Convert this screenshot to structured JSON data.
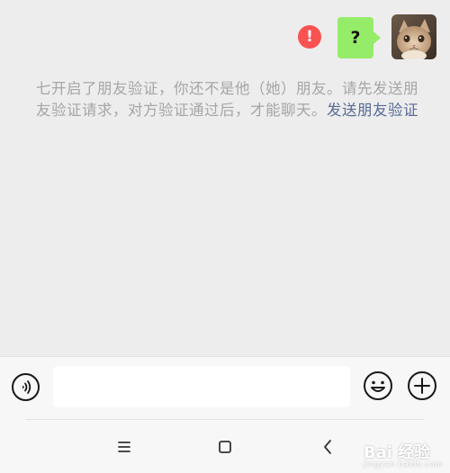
{
  "message": {
    "bubble_text": "?",
    "status": "failed",
    "error_mark": "!",
    "colors": {
      "bubble": "#95ec69",
      "error": "#fa5151"
    }
  },
  "system_notice": {
    "text": "七开启了朋友验证，你还不是他（她）朋友。请先发送朋友验证请求，对方验证通过后，才能聊天。",
    "link_text": "发送朋友验证",
    "colors": {
      "text": "#a6a6a6",
      "link": "#576b95"
    }
  },
  "input_bar": {
    "voice_icon": "voice-icon",
    "input_value": "",
    "emoji_icon": "emoji-icon",
    "plus_icon": "plus-icon"
  },
  "nav_bar": {
    "menu_icon": "menu-icon",
    "home_icon": "home-icon",
    "back_icon": "back-icon"
  },
  "watermark": {
    "brand": "Bai 经验",
    "url": "jingyan.baidu.com"
  }
}
